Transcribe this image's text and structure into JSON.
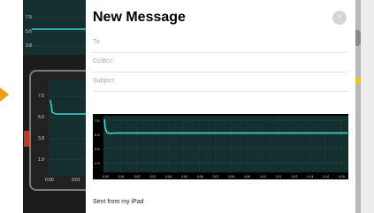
{
  "compose": {
    "title": "New Message",
    "send_icon": "arrow-up-icon",
    "to_label": "To:",
    "ccbcc_label": "Cc/Bcc:",
    "subject_label": "Subject:",
    "signature": "Sent from my iPad"
  },
  "background_chart": {
    "top_ticks": [
      "7.5",
      "5.6",
      "3.8"
    ],
    "pip_y_ticks": [
      "7.5",
      "5.6",
      "3.8",
      "1.9"
    ],
    "pip_x_ticks": [
      "0:00",
      "0:01"
    ]
  },
  "attachment_chart": {
    "y_ticks": [
      "7.5",
      "5.6",
      "3.8",
      "1.9"
    ],
    "x_ticks": [
      "0:00",
      "0:01",
      "0:02",
      "0:03",
      "0:04",
      "0:05",
      "0:06",
      "0:07",
      "0:08",
      "0:09",
      "0:10",
      "0:11",
      "0:12",
      "0:13",
      "0:14",
      "0:15"
    ]
  },
  "colors": {
    "trace": "#3fd3d3",
    "chart_bg": "#14302e",
    "accent_orange": "#f39c12"
  }
}
